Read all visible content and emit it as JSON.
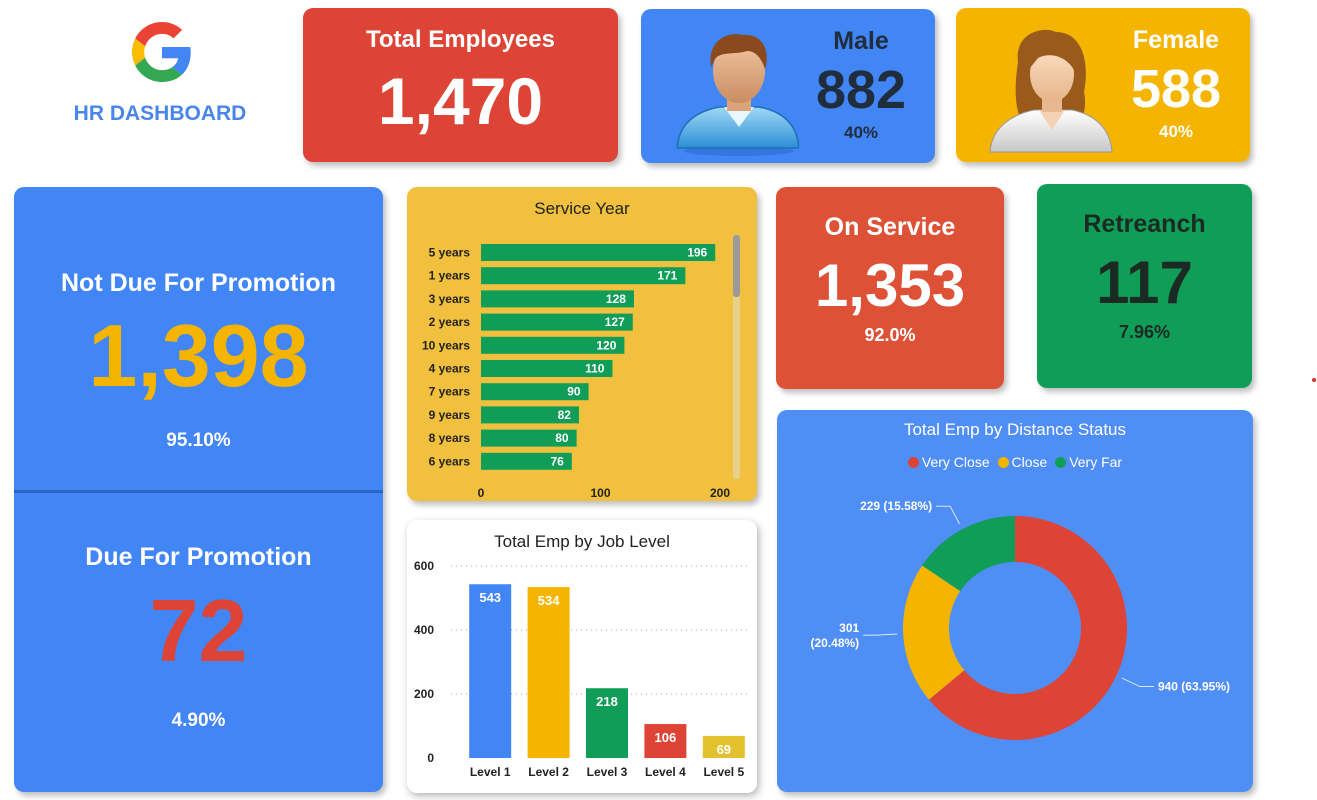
{
  "header": {
    "title": "HR DASHBOARD",
    "logo_icon": "google-g-logo"
  },
  "colors": {
    "red": "#dd4435",
    "blue": "#4285f4",
    "yellow": "#f4b400",
    "green": "#0f9d58",
    "title_blue": "#4a86e8"
  },
  "total": {
    "title": "Total Employees",
    "value": "1,470"
  },
  "male": {
    "title": "Male",
    "value": "882",
    "pct": "40%",
    "icon": "male-avatar-icon"
  },
  "female": {
    "title": "Female",
    "value": "588",
    "pct": "40%",
    "icon": "female-avatar-icon"
  },
  "promotion": {
    "not_due": {
      "title": "Not Due For Promotion",
      "value": "1,398",
      "pct": "95.10%"
    },
    "due": {
      "title": "Due For Promotion",
      "value": "72",
      "pct": "4.90%"
    }
  },
  "on_service": {
    "title": "On Service",
    "value": "1,353",
    "pct": "92.0%"
  },
  "retreanch": {
    "title": "Retreanch",
    "value": "117",
    "pct": "7.96%"
  },
  "chart_data": [
    {
      "type": "bar",
      "orientation": "horizontal",
      "title": "Service Year",
      "categories": [
        "5 years",
        "1 years",
        "3 years",
        "2 years",
        "10 years",
        "4 years",
        "7 years",
        "9 years",
        "8 years",
        "6 years"
      ],
      "values": [
        196,
        171,
        128,
        127,
        120,
        110,
        90,
        82,
        80,
        76
      ],
      "xticks": [
        "0",
        "100",
        "200"
      ],
      "xlim": [
        0,
        200
      ],
      "bar_color": "#0f9d58"
    },
    {
      "type": "bar",
      "title": "Total Emp by Job Level",
      "categories": [
        "Level 1",
        "Level 2",
        "Level 3",
        "Level 4",
        "Level 5"
      ],
      "values": [
        543,
        534,
        218,
        106,
        69
      ],
      "colors": [
        "#4285f4",
        "#f4b400",
        "#0f9d58",
        "#dd4435",
        "#e3c02e"
      ],
      "yticks": [
        "0",
        "200",
        "400",
        "600"
      ],
      "ylim": [
        0,
        600
      ],
      "grid": true
    },
    {
      "type": "pie",
      "subtype": "donut",
      "title": "Total Emp by Distance Status",
      "labels": [
        "Very Close",
        "Close",
        "Very Far"
      ],
      "values": [
        940,
        301,
        229
      ],
      "data_labels": [
        "940 (63.95%)",
        "301 (20.48%)",
        "229 (15.58%)"
      ],
      "colors": [
        "#dd4435",
        "#f4b400",
        "#0f9d58"
      ],
      "legend": "top"
    }
  ]
}
